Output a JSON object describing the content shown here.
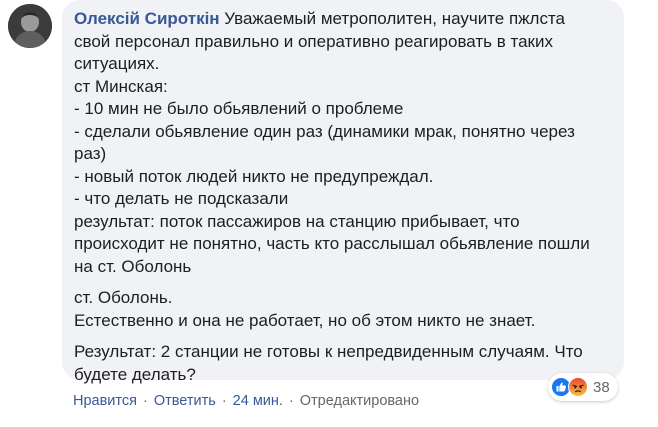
{
  "comment": {
    "author": "Олексій Сироткін",
    "lines": [
      "Уважаемый метрополитен, научите пжлста",
      "свой персонал правильно и оперативно реагировать в таких",
      "ситуациях.",
      "ст Минская:",
      "- 10 мин не было обьявлений о проблеме",
      "- сделали обьявление один раз (динамики мрак, понятно через",
      "раз)",
      "- новый поток людей никто не предупреждал.",
      "- что делать не подсказали",
      "результат: поток пассажиров на станцию прибывает, что",
      "происходит не понятно, часть кто расслышал обьявление пошли",
      "на ст. Оболонь",
      "ст. Оболонь.",
      "Естественно и она не работает, но об этом никто не знает.",
      "Результат: 2 станции не готовы к непредвиденным случаям. Что",
      "будете делать?"
    ],
    "first_line_rest": " Уважаемый метрополитен, научите пжлста"
  },
  "reactions": {
    "icons": [
      "like-icon",
      "angry-icon"
    ],
    "count": "38"
  },
  "actions": {
    "like": "Нравится",
    "reply": "Ответить",
    "time": "24 мин.",
    "edited": "Отредактировано",
    "separator": "·"
  },
  "colors": {
    "bubble": "#f0f2f5",
    "author": "#385898",
    "meta": "#65676b",
    "like": "#1877f2",
    "angry": "#f0663b"
  }
}
